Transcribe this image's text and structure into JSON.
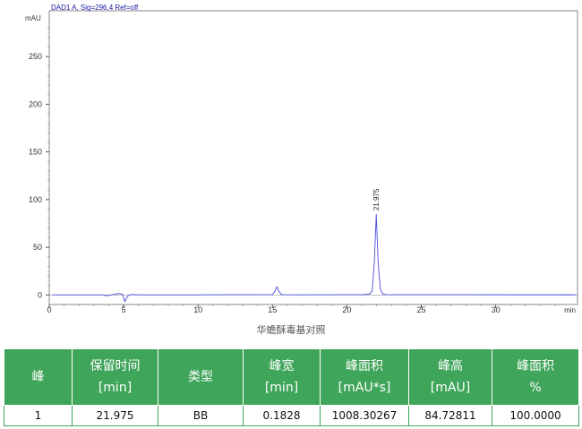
{
  "chart_data": {
    "type": "line",
    "signal_label": "DAD1 A, Sig=296,4 Ref=off",
    "ylabel": "mAU",
    "xlabel": "min",
    "xlim": [
      0,
      35.5
    ],
    "ylim": [
      -10,
      298
    ],
    "x_ticks": [
      "0",
      "5",
      "10",
      "15",
      "20",
      "25",
      "30"
    ],
    "y_ticks": [
      "0",
      "50",
      "100",
      "150",
      "200",
      "250"
    ],
    "peak_label": "21.975",
    "line_color": "#4a4ae0",
    "series": [
      {
        "x": [
          0.2,
          3.6,
          3.8,
          4.0,
          4.4,
          4.7,
          4.9,
          5.0,
          5.05,
          5.1,
          5.2,
          5.3,
          5.4,
          5.6,
          6.0,
          10.0,
          15.0,
          15.15,
          15.3,
          15.45,
          15.6,
          15.8,
          16.5,
          21.0,
          21.5,
          21.7,
          21.85,
          21.975,
          22.1,
          22.25,
          22.4,
          22.6,
          23.0,
          35.4
        ],
        "y": [
          0.2,
          0.2,
          -0.8,
          -0.6,
          0.8,
          1.6,
          1.0,
          -2.5,
          -6.2,
          -6.8,
          -3.0,
          -0.8,
          0.2,
          0.4,
          0.2,
          0.2,
          0.4,
          3.5,
          8.5,
          3.5,
          0.5,
          0.3,
          0.2,
          0.3,
          0.8,
          4.0,
          35.0,
          84.7,
          34.0,
          6.0,
          1.2,
          0.4,
          0.3,
          0.2
        ]
      }
    ]
  },
  "caption": "华蟾酥毒基对照",
  "table": {
    "header_color": "#3fa55a",
    "headers": [
      [
        "峰"
      ],
      [
        "保留时间",
        "[min]"
      ],
      [
        "类型"
      ],
      [
        "峰宽",
        "[min]"
      ],
      [
        "峰面积",
        "[mAU*s]"
      ],
      [
        "峰高",
        "[mAU]"
      ],
      [
        "峰面积",
        "%"
      ]
    ],
    "rows": [
      [
        "1",
        "21.975",
        "BB",
        "0.1828",
        "1008.30267",
        "84.72811",
        "100.0000"
      ]
    ]
  }
}
